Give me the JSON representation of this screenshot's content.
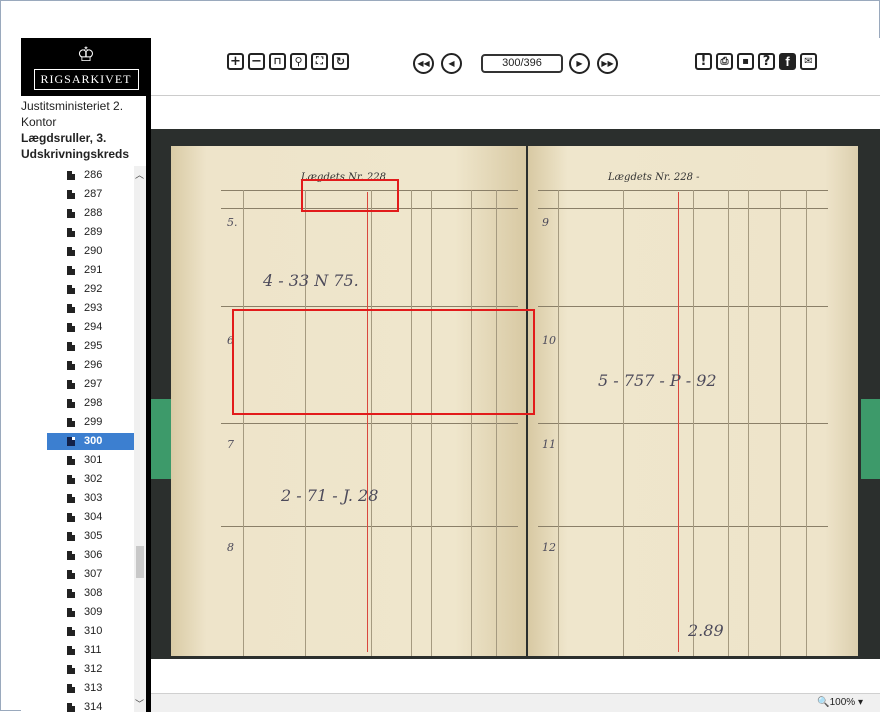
{
  "logo": {
    "name": "Rigsarkivet"
  },
  "toolbar": {
    "page_indicator": "300/396",
    "buttons": [
      "zoom-in-icon",
      "zoom-out-icon",
      "lock-icon",
      "magnifier-icon",
      "fullscreen-icon",
      "rotate-icon",
      "first-page-icon",
      "prev-page-icon",
      "next-page-icon",
      "last-page-icon",
      "report-icon",
      "print-icon",
      "save-icon",
      "help-icon",
      "facebook-icon",
      "email-icon"
    ]
  },
  "sidebar": {
    "breadcrumb_line1": "Justitsministeriet 2. Kontor",
    "breadcrumb_line2": "Lægdsruller, 3. Udskrivningskreds",
    "items": [
      "286",
      "287",
      "288",
      "289",
      "290",
      "291",
      "292",
      "293",
      "294",
      "295",
      "296",
      "297",
      "298",
      "299",
      "300",
      "301",
      "302",
      "303",
      "304",
      "305",
      "306",
      "307",
      "308",
      "309",
      "310",
      "311",
      "312",
      "313",
      "314"
    ],
    "selected": "300"
  },
  "document": {
    "left_header": "Lægdets Nr. 228",
    "right_header": "Lægdets Nr. 228 -",
    "left_hand_1": "4 - 33 N 75.",
    "left_hand_2": "2 - 71 - J. 28",
    "right_hand_1": "5 - 757 - P - 92",
    "right_hand_2": "2.89",
    "row_numbers_left": [
      "5.",
      "6",
      "7",
      "8"
    ],
    "row_numbers_right": [
      "9",
      "10",
      "11",
      "12"
    ]
  },
  "status": {
    "zoom": "100%"
  }
}
